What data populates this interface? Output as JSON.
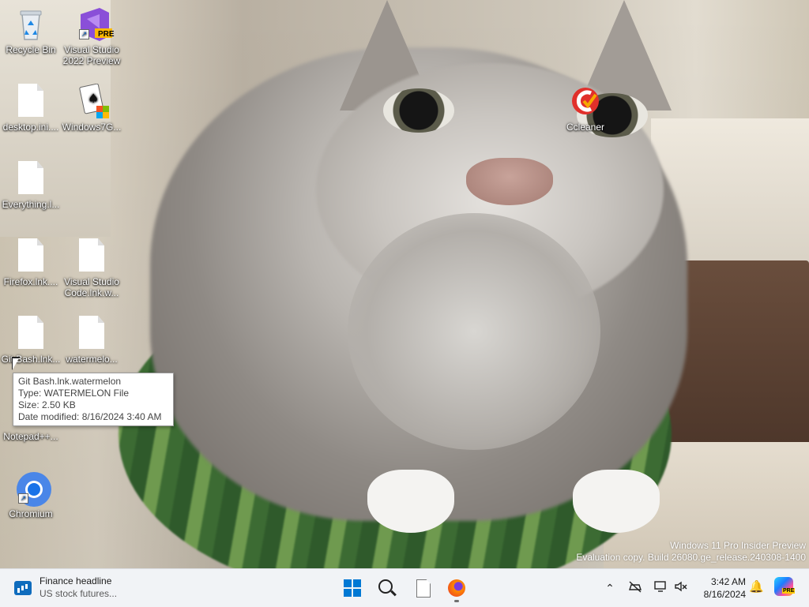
{
  "desktop": {
    "icons": [
      {
        "label": "Recycle Bin",
        "icon": "recycle-bin-icon"
      },
      {
        "label": "Visual Studio 2022 Preview",
        "icon": "visual-studio-icon",
        "badge": "PRE"
      },
      {
        "label": "desktop.ini....",
        "icon": "document-icon"
      },
      {
        "label": "Windows7G...",
        "icon": "solitaire-icon"
      },
      {
        "label": "Ccleaner",
        "icon": "ccleaner-icon"
      },
      {
        "label": "Everything.l...",
        "icon": "document-icon"
      },
      {
        "label": "Firefox.lnk....",
        "icon": "document-icon"
      },
      {
        "label": "Visual Studio Code.lnk.w...",
        "icon": "document-icon"
      },
      {
        "label": "Git Bash.lnk...",
        "icon": "document-icon"
      },
      {
        "label": "watermelo...",
        "icon": "document-icon"
      },
      {
        "label": "Notepad++...",
        "icon": "document-icon"
      },
      {
        "label": "Chromium",
        "icon": "chromium-icon"
      }
    ]
  },
  "tooltip": {
    "name": "Git Bash.lnk.watermelon",
    "type": "Type: WATERMELON File",
    "size": "Size: 2.50 KB",
    "modified": "Date modified: 8/16/2024 3:40 AM"
  },
  "watermark": {
    "line1": "Windows 11 Pro Insider Preview",
    "line2": "Evaluation copy. Build 26080.ge_release.240308-1400"
  },
  "taskbar": {
    "widget_title": "Finance headline",
    "widget_subtitle": "US stock futures...",
    "time": "3:42 AM",
    "date": "8/16/2024",
    "copilot_badge": "PRE"
  },
  "colors": {
    "accent": "#0078d4",
    "taskbar_bg": "#f1f3f6"
  }
}
